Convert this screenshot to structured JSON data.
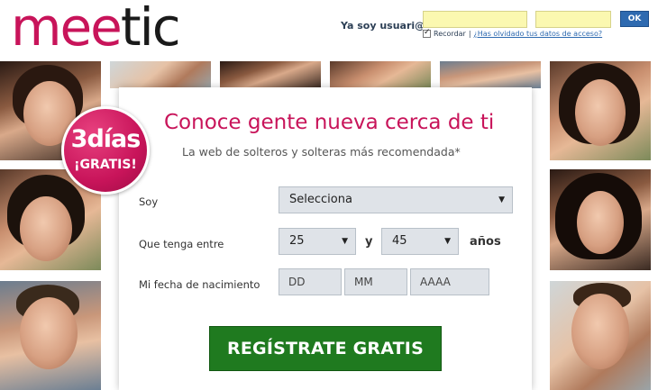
{
  "brand": {
    "logo_pre": "mee",
    "logo_post": "tic",
    "primary_color": "#c8145a",
    "cta_color": "#1f7a1f"
  },
  "login": {
    "label": "Ya soy usuari@",
    "ok_label": "OK",
    "remember_label": "Recordar",
    "separator": "|",
    "forgot_label": "¿Has olvidado tus datos de acceso?"
  },
  "badge": {
    "line1": "3días",
    "line2": "¡GRATIS!"
  },
  "form": {
    "headline": "Conoce gente nueva cerca de ti",
    "subheadline": "La web de solteros y solteras más recomendada*",
    "soy_label": "Soy",
    "soy_value": "Selecciona",
    "age_label": "Que tenga entre",
    "age_min": "25",
    "age_and": "y",
    "age_max": "45",
    "age_unit": "años",
    "birth_label": "Mi fecha de nacimiento",
    "day_placeholder": "DD",
    "month_placeholder": "MM",
    "year_placeholder": "AAAA",
    "cta_label": "REGÍSTRATE GRATIS"
  },
  "icons": {
    "dropdown": "chevron-down-icon",
    "checkbox": "checkmark-icon"
  }
}
